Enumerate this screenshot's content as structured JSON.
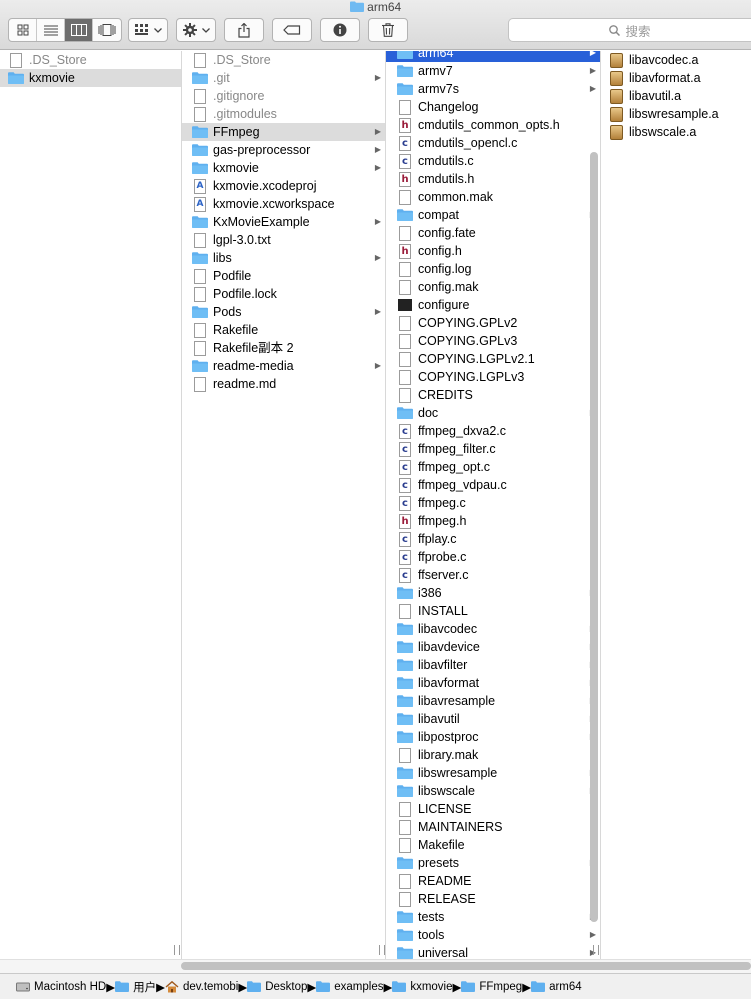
{
  "window": {
    "title": "arm64"
  },
  "search": {
    "placeholder": "搜索"
  },
  "colors": {
    "selection": "#2860d8",
    "folder": "#5fb0ef"
  },
  "columns": [
    {
      "items": [
        {
          "name": ".DS_Store",
          "type": "doc",
          "dim": true
        },
        {
          "name": "kxmovie",
          "type": "folder",
          "selected": "gray"
        }
      ]
    },
    {
      "items": [
        {
          "name": ".DS_Store",
          "type": "doc",
          "dim": true
        },
        {
          "name": ".git",
          "type": "folder",
          "dim": true,
          "arrow": true
        },
        {
          "name": ".gitignore",
          "type": "doc",
          "dim": true
        },
        {
          "name": ".gitmodules",
          "type": "doc",
          "dim": true
        },
        {
          "name": "FFmpeg",
          "type": "folder",
          "arrow": true,
          "selected": "gray"
        },
        {
          "name": "gas-preprocessor",
          "type": "folder",
          "arrow": true
        },
        {
          "name": "kxmovie",
          "type": "folder",
          "arrow": true
        },
        {
          "name": "kxmovie.xcodeproj",
          "type": "xcode"
        },
        {
          "name": "kxmovie.xcworkspace",
          "type": "xcode"
        },
        {
          "name": "KxMovieExample",
          "type": "folder",
          "arrow": true
        },
        {
          "name": "lgpl-3.0.txt",
          "type": "doc"
        },
        {
          "name": "libs",
          "type": "folder",
          "arrow": true
        },
        {
          "name": "Podfile",
          "type": "doc"
        },
        {
          "name": "Podfile.lock",
          "type": "doc"
        },
        {
          "name": "Pods",
          "type": "folder",
          "arrow": true
        },
        {
          "name": "Rakefile",
          "type": "doc"
        },
        {
          "name": "Rakefile副本 2",
          "type": "doc"
        },
        {
          "name": "readme-media",
          "type": "folder",
          "arrow": true
        },
        {
          "name": "readme.md",
          "type": "doc"
        }
      ]
    },
    {
      "items": [
        {
          "name": "arm64",
          "type": "folder",
          "arrow": true,
          "selected": "blue"
        },
        {
          "name": "armv7",
          "type": "folder",
          "arrow": true
        },
        {
          "name": "armv7s",
          "type": "folder",
          "arrow": true
        },
        {
          "name": "Changelog",
          "type": "doc"
        },
        {
          "name": "cmdutils_common_opts.h",
          "type": "h"
        },
        {
          "name": "cmdutils_opencl.c",
          "type": "c"
        },
        {
          "name": "cmdutils.c",
          "type": "c"
        },
        {
          "name": "cmdutils.h",
          "type": "h"
        },
        {
          "name": "common.mak",
          "type": "doc"
        },
        {
          "name": "compat",
          "type": "folder",
          "arrow": true
        },
        {
          "name": "config.fate",
          "type": "doc"
        },
        {
          "name": "config.h",
          "type": "h"
        },
        {
          "name": "config.log",
          "type": "doc"
        },
        {
          "name": "config.mak",
          "type": "doc"
        },
        {
          "name": "configure",
          "type": "term"
        },
        {
          "name": "COPYING.GPLv2",
          "type": "doc"
        },
        {
          "name": "COPYING.GPLv3",
          "type": "doc"
        },
        {
          "name": "COPYING.LGPLv2.1",
          "type": "doc"
        },
        {
          "name": "COPYING.LGPLv3",
          "type": "doc"
        },
        {
          "name": "CREDITS",
          "type": "doc"
        },
        {
          "name": "doc",
          "type": "folder",
          "arrow": true
        },
        {
          "name": "ffmpeg_dxva2.c",
          "type": "c"
        },
        {
          "name": "ffmpeg_filter.c",
          "type": "c"
        },
        {
          "name": "ffmpeg_opt.c",
          "type": "c"
        },
        {
          "name": "ffmpeg_vdpau.c",
          "type": "c"
        },
        {
          "name": "ffmpeg.c",
          "type": "c"
        },
        {
          "name": "ffmpeg.h",
          "type": "h"
        },
        {
          "name": "ffplay.c",
          "type": "c"
        },
        {
          "name": "ffprobe.c",
          "type": "c"
        },
        {
          "name": "ffserver.c",
          "type": "c"
        },
        {
          "name": "i386",
          "type": "folder",
          "arrow": true
        },
        {
          "name": "INSTALL",
          "type": "doc"
        },
        {
          "name": "libavcodec",
          "type": "folder",
          "arrow": true
        },
        {
          "name": "libavdevice",
          "type": "folder",
          "arrow": true
        },
        {
          "name": "libavfilter",
          "type": "folder",
          "arrow": true
        },
        {
          "name": "libavformat",
          "type": "folder",
          "arrow": true
        },
        {
          "name": "libavresample",
          "type": "folder",
          "arrow": true
        },
        {
          "name": "libavutil",
          "type": "folder",
          "arrow": true
        },
        {
          "name": "libpostproc",
          "type": "folder",
          "arrow": true
        },
        {
          "name": "library.mak",
          "type": "doc"
        },
        {
          "name": "libswresample",
          "type": "folder",
          "arrow": true
        },
        {
          "name": "libswscale",
          "type": "folder",
          "arrow": true
        },
        {
          "name": "LICENSE",
          "type": "doc"
        },
        {
          "name": "MAINTAINERS",
          "type": "doc"
        },
        {
          "name": "Makefile",
          "type": "doc"
        },
        {
          "name": "presets",
          "type": "folder",
          "arrow": true
        },
        {
          "name": "README",
          "type": "doc"
        },
        {
          "name": "RELEASE",
          "type": "doc"
        },
        {
          "name": "tests",
          "type": "folder",
          "arrow": true
        },
        {
          "name": "tools",
          "type": "folder",
          "arrow": true
        },
        {
          "name": "universal",
          "type": "folder",
          "arrow": true
        }
      ]
    },
    {
      "items": [
        {
          "name": "libavcodec.a",
          "type": "lib"
        },
        {
          "name": "libavformat.a",
          "type": "lib"
        },
        {
          "name": "libavutil.a",
          "type": "lib"
        },
        {
          "name": "libswresample.a",
          "type": "lib"
        },
        {
          "name": "libswscale.a",
          "type": "lib"
        }
      ]
    }
  ],
  "pathbar": [
    {
      "label": "Macintosh HD",
      "icon": "hard-drive-icon"
    },
    {
      "label": "用户",
      "icon": "folder-icon"
    },
    {
      "label": "dev.temobi",
      "icon": "home-icon"
    },
    {
      "label": "Desktop",
      "icon": "folder-icon"
    },
    {
      "label": "examples",
      "icon": "folder-icon"
    },
    {
      "label": "kxmovie",
      "icon": "folder-icon"
    },
    {
      "label": "FFmpeg",
      "icon": "folder-icon"
    },
    {
      "label": "arm64",
      "icon": "folder-icon"
    }
  ]
}
